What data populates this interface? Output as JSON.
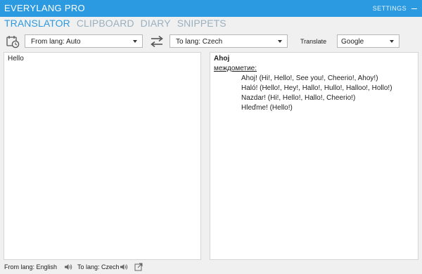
{
  "window": {
    "title": "EVERYLANG PRO",
    "settings_label": "SETTINGS"
  },
  "tabs": [
    {
      "label": "TRANSLATOR",
      "active": true
    },
    {
      "label": "CLIPBOARD",
      "active": false
    },
    {
      "label": "DIARY",
      "active": false
    },
    {
      "label": "SNIPPETS",
      "active": false
    }
  ],
  "toolbar": {
    "from_lang": "From lang: Auto",
    "to_lang": "To lang: Czech",
    "translate_label": "Translate",
    "service": "Google"
  },
  "source": {
    "text": "Hello"
  },
  "result": {
    "word": "Ahoj",
    "part_of_speech": "междометие:",
    "meanings": [
      "Ahoj! (Hi!, Hello!, See you!, Cheerio!, Ahoy!)",
      "Haló! (Hello!, Hey!, Hallo!, Hullo!, Halloo!, Hollo!)",
      "Nazdar! (Hi!, Hello!, Hallo!, Cheerio!)",
      "Hleďme! (Hello!)"
    ]
  },
  "status": {
    "from": "From lang: English",
    "to": "To lang: Czech"
  },
  "colors": {
    "accent": "#2b9ae0",
    "inactive_tab": "#9ab0bf"
  },
  "icons": [
    "history-icon",
    "swap-icon",
    "speaker-icon",
    "open-external-icon",
    "chevron-down-icon"
  ]
}
